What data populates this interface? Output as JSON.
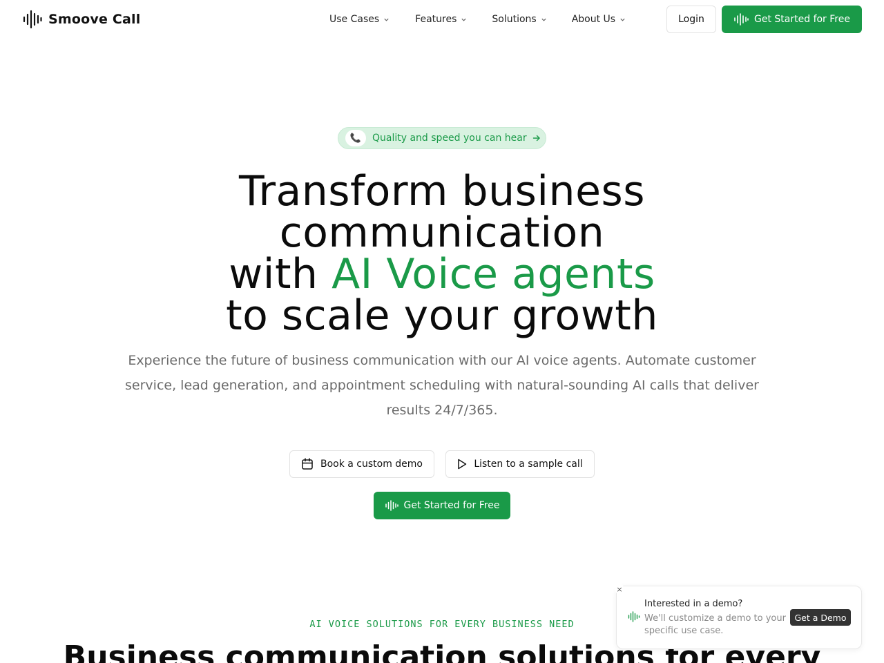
{
  "brand": {
    "name": "Smoove Call",
    "logo_icon": "waveform-icon"
  },
  "nav": {
    "items": [
      {
        "label": "Use Cases"
      },
      {
        "label": "Features"
      },
      {
        "label": "Solutions"
      },
      {
        "label": "About Us"
      }
    ]
  },
  "header": {
    "login_label": "Login",
    "cta_label": "Get Started for Free"
  },
  "hero": {
    "pill_text": "Quality and speed you can hear",
    "title_line1": "Transform business",
    "title_line2": "communication",
    "title_line3_prefix": "with ",
    "title_line3_highlight": "AI Voice agents",
    "title_line4": "to scale your growth",
    "subtitle": "Experience the future of business communication with our AI voice agents. Automate customer service, lead generation, and appointment scheduling with natural-sounding AI calls that deliver results 24/7/365.",
    "demo_button": "Book a custom demo",
    "sample_button": "Listen to a sample call",
    "cta_button": "Get Started for Free"
  },
  "section": {
    "eyebrow": "AI VOICE SOLUTIONS FOR EVERY BUSINESS NEED",
    "title": "Business communication solutions for every"
  },
  "popup": {
    "close": "×",
    "title": "Interested in a demo?",
    "text": "We'll customize a demo to your specific use case.",
    "button": "Get a Demo"
  },
  "colors": {
    "brand_green": "#1a9a48",
    "pill_bg": "#d9f2e1",
    "muted_text": "#6b6b6b"
  }
}
